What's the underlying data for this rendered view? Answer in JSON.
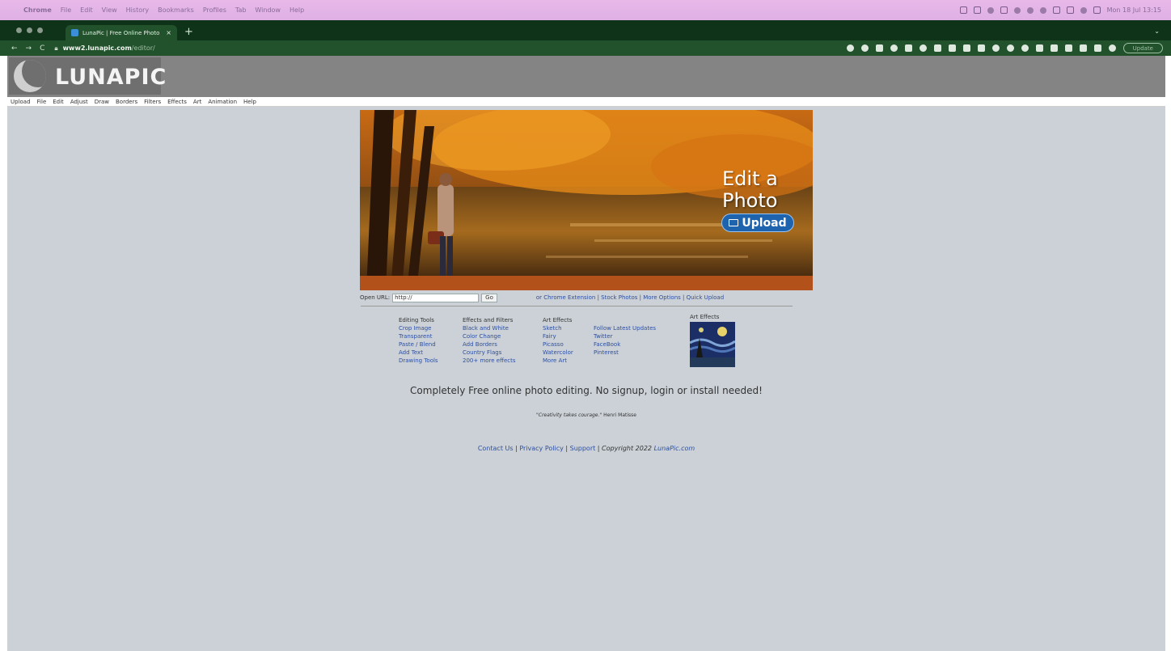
{
  "menubar": {
    "app": "Chrome",
    "items": [
      "File",
      "Edit",
      "View",
      "History",
      "Bookmarks",
      "Profiles",
      "Tab",
      "Window",
      "Help"
    ],
    "clock": "Mon 18 Jul 13:15"
  },
  "tab": {
    "title": "LunaPic | Free Online Photo Ed",
    "close": "×"
  },
  "address": {
    "host": "www2.lunapic.com",
    "path": "/editor/",
    "update_label": "Update"
  },
  "logo_text": "LUNAPIC",
  "luna_menu": [
    "Upload",
    "File",
    "Edit",
    "Adjust",
    "Draw",
    "Borders",
    "Filters",
    "Effects",
    "Art",
    "Animation",
    "Help"
  ],
  "hero": {
    "title_line1": "Edit a",
    "title_line2": "Photo",
    "upload_label": "Upload"
  },
  "open_url": {
    "label": "Open URL:",
    "value": "http://",
    "go_label": "Go",
    "prefix": "or",
    "links": [
      "Chrome Extension",
      "Stock Photos",
      "More Options",
      "Quick Upload"
    ]
  },
  "columns": {
    "editing": {
      "title": "Editing Tools",
      "items": [
        "Crop Image",
        "Transparent",
        "Paste / Blend",
        "Add Text",
        "Drawing Tools"
      ]
    },
    "effects": {
      "title": "Effects and Filters",
      "items": [
        "Black and White",
        "Color Change",
        "Add Borders",
        "Country Flags",
        "200+ more effects"
      ]
    },
    "art": {
      "title": "Art Effects",
      "items": [
        "Sketch",
        "Fairy",
        "Picasso",
        "Watercolor",
        "More Art"
      ]
    },
    "social": {
      "items": [
        "Follow Latest Updates",
        "Twitter",
        "FaceBook",
        "Pinterest"
      ]
    }
  },
  "art_box_label": "Art Effects",
  "tagline": "Completely Free online photo editing. No signup, login or install needed!",
  "quote": {
    "text": "\"Creativity takes courage.\"",
    "author": "Henri Matisse"
  },
  "footer": {
    "contact": "Contact Us",
    "privacy": "Privacy Policy",
    "support": "Support",
    "copyright": "Copyright 2022",
    "site": "LunaPic.com"
  },
  "colors": {
    "page_bg": "#cbd1d7",
    "link": "#2d4fa0",
    "header_bg": "#848484",
    "tabbar_bg": "#0f3319",
    "addrbar_bg": "#21522c",
    "upload_btn": "#1d63ad"
  }
}
